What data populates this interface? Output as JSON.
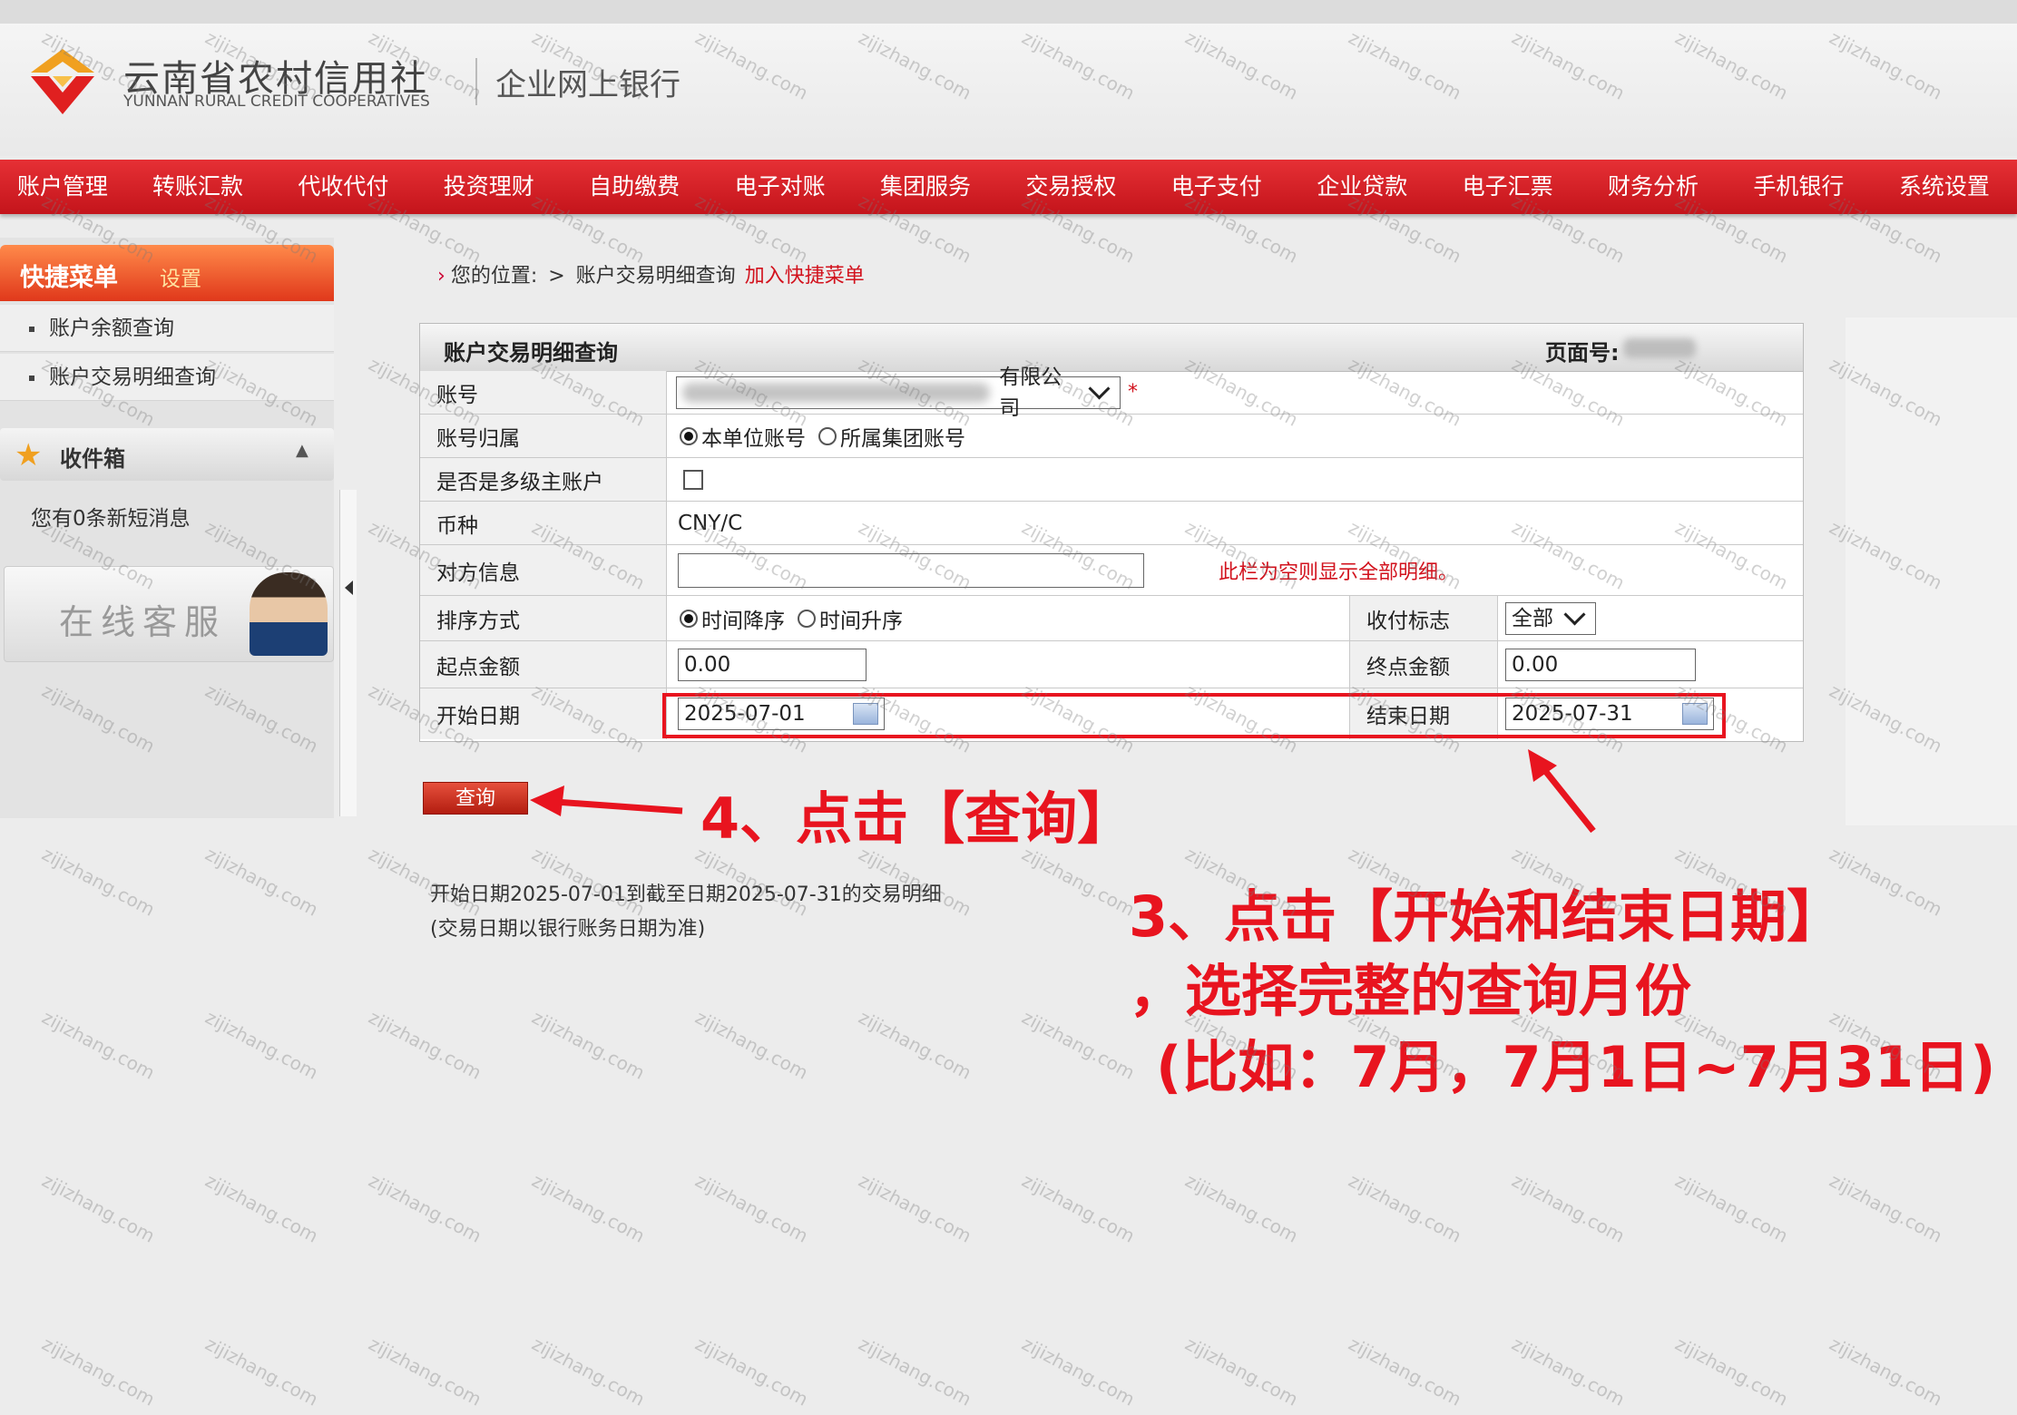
{
  "header": {
    "bank_name_cn": "云南省农村信用社",
    "bank_name_en": "YUNNAN RURAL CREDIT COOPERATIVES",
    "subtitle": "企业网上银行"
  },
  "nav": {
    "items": [
      "账户管理",
      "转账汇款",
      "代收代付",
      "投资理财",
      "自助缴费",
      "电子对账",
      "集团服务",
      "交易授权",
      "电子支付",
      "企业贷款",
      "电子汇票",
      "财务分析",
      "手机银行",
      "系统设置"
    ]
  },
  "sidebar": {
    "quick_menu_title": "快捷菜单",
    "quick_menu_settings": "设置",
    "quick_items": [
      "账户余额查询",
      "账户交易明细查询"
    ],
    "inbox_title": "收件箱",
    "inbox_message": "您有0条新短消息",
    "customer_service": "在线客服"
  },
  "breadcrumb": {
    "location_label": "您的位置:",
    "separator": ">",
    "current": "账户交易明细查询",
    "add_quick": "加入快捷菜单"
  },
  "panel": {
    "title": "账户交易明细查询",
    "page_no_label": "页面号:",
    "rows": {
      "account": {
        "label": "账号",
        "value_suffix": "有限公司",
        "required": "*"
      },
      "account_owner": {
        "label": "账号归属",
        "option1": "本单位账号",
        "option2": "所属集团账号"
      },
      "multilevel": {
        "label": "是否是多级主账户"
      },
      "currency": {
        "label": "币种",
        "value": "CNY/C"
      },
      "counterparty": {
        "label": "对方信息",
        "hint": "此栏为空则显示全部明细。"
      },
      "sort": {
        "label": "排序方式",
        "option1": "时间降序",
        "option2": "时间升序",
        "flag_label": "收付标志",
        "flag_value": "全部"
      },
      "amount": {
        "label": "起点金额",
        "start_value": "0.00",
        "end_label": "终点金额",
        "end_value": "0.00"
      },
      "dates": {
        "label": "开始日期",
        "start_value": "2025-07-01",
        "end_label": "结束日期",
        "end_value": "2025-07-31"
      }
    }
  },
  "query_button": "查询",
  "result": {
    "line1": "开始日期2025-07-01到截至日期2025-07-31的交易明细",
    "line2": "(交易日期以银行账务日期为准)"
  },
  "annotations": {
    "step4": "4、点击【查询】",
    "step3_line1": "3、点击【开始和结束日期】",
    "step3_line2": "，选择完整的查询月份",
    "step3_line3": "(比如：7月，7月1日~7月31日)"
  },
  "watermark": "zijizhang.com",
  "colors": {
    "brand_red": "#d2121d",
    "annotation_red": "#e8141f"
  }
}
